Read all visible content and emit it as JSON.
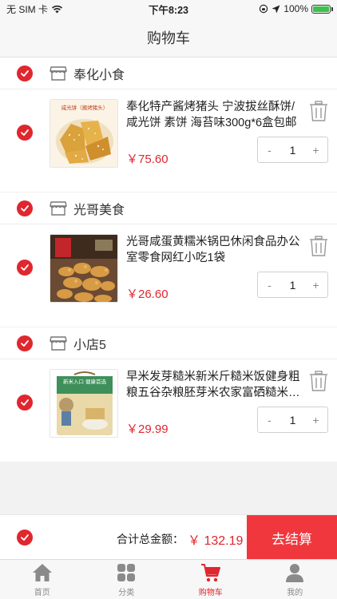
{
  "status_bar": {
    "carrier": "无 SIM 卡",
    "time": "下午8:23",
    "battery": "100%",
    "battery_level": 1.0
  },
  "nav": {
    "title": "购物车"
  },
  "stores": [
    {
      "name": "奉化小食",
      "item": {
        "title": "奉化特产酱烤猪头 宁波拔丝酥饼/咸光饼 素饼 海苔味300g*6盒包邮",
        "price": "￥75.60",
        "quantity": "1",
        "thumb_caption": "咸光饼（酱烤猪头）"
      }
    },
    {
      "name": "光哥美食",
      "item": {
        "title": "光哥咸蛋黄糯米锅巴休闲食品办公室零食网红小吃1袋",
        "price": "￥26.60",
        "quantity": "1"
      }
    },
    {
      "name": "小店5",
      "item": {
        "title": "早米发芽糙米新米斤糙米饭健身粗粮五谷杂粮胚芽米农家富硒糙米…",
        "price": "￥29.99",
        "quantity": "1",
        "thumb_caption": "新米入口 健康首选"
      }
    }
  ],
  "stepper": {
    "minus": "-",
    "plus": "+"
  },
  "checkout": {
    "total_label": "合计总金额：",
    "total_value": "￥ 132.19",
    "button_label": "去结算"
  },
  "tabs": [
    {
      "label": "首页",
      "icon": "home-icon",
      "active": false
    },
    {
      "label": "分类",
      "icon": "grid-icon",
      "active": false
    },
    {
      "label": "购物车",
      "icon": "cart-icon",
      "active": true
    },
    {
      "label": "我的",
      "icon": "user-icon",
      "active": false
    }
  ],
  "colors": {
    "accent": "#e0262e",
    "checkout_button": "#f0373d",
    "background": "#f2f2f2"
  }
}
